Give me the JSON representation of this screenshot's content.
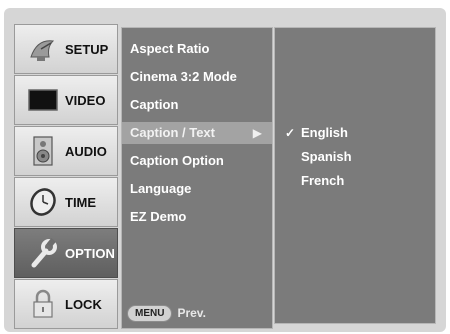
{
  "tabs": [
    {
      "label": "SETUP",
      "icon": "satellite-dish-icon"
    },
    {
      "label": "VIDEO",
      "icon": "tv-screen-icon"
    },
    {
      "label": "AUDIO",
      "icon": "speaker-icon"
    },
    {
      "label": "TIME",
      "icon": "clock-icon"
    },
    {
      "label": "OPTION",
      "icon": "wrench-icon"
    },
    {
      "label": "LOCK",
      "icon": "padlock-icon"
    }
  ],
  "active_tab": "OPTION",
  "menu": {
    "items": [
      {
        "label": "Aspect Ratio"
      },
      {
        "label": "Cinema 3:2 Mode"
      },
      {
        "label": "Caption"
      },
      {
        "label": "Caption / Text",
        "arrow": "▶"
      },
      {
        "label": "Caption Option"
      },
      {
        "label": "Language"
      },
      {
        "label": "EZ Demo"
      }
    ],
    "selected": "Caption / Text",
    "menu_button": "MENU",
    "prev_label": "Prev."
  },
  "submenu": {
    "items": [
      {
        "label": "English",
        "check": "✓"
      },
      {
        "label": "Spanish",
        "check": ""
      },
      {
        "label": "French",
        "check": ""
      }
    ],
    "selected": "English"
  },
  "colors": {
    "panel": "#7b7b7b",
    "active_tab": "#6e6e6e",
    "selected_row": "#a3a3a3",
    "background": "#d6d6d6"
  }
}
